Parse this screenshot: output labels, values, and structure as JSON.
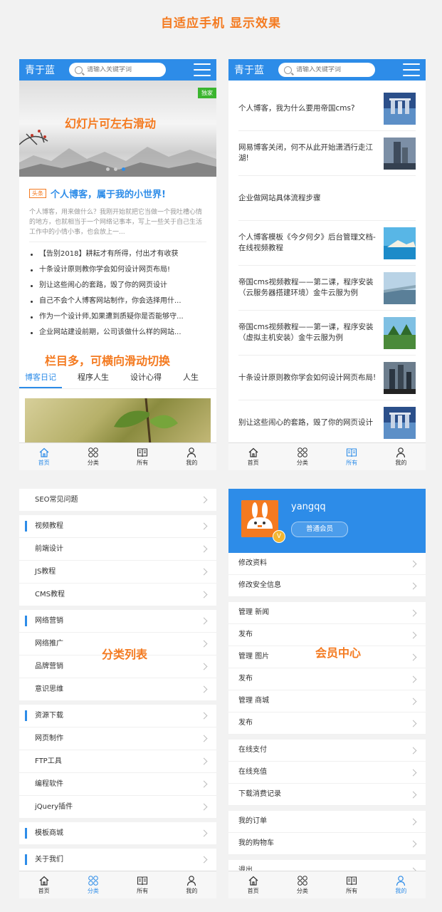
{
  "page_title": "自适应手机 显示效果",
  "header": {
    "logo": "青于蓝",
    "search_placeholder": "请输入关键字词"
  },
  "annotations": {
    "slider": "幻灯片可左右滑动",
    "tabs": "栏目多，可横向滑动切换",
    "category": "分类列表",
    "member": "会员中心"
  },
  "tabbar": [
    {
      "label": "首页",
      "icon": "home-icon"
    },
    {
      "label": "分类",
      "icon": "grid-icon"
    },
    {
      "label": "所有",
      "icon": "book-icon"
    },
    {
      "label": "我的",
      "icon": "user-icon"
    }
  ],
  "phone1": {
    "badge": "独家",
    "headline_tag": "头条",
    "headline_title": "个人博客，属于我的小世界!",
    "summary": "个人博客，用来做什么？我刚开始就把它当做一个我吐槽心情的地方，也就相当于一个网络记事本，写上一些关于自己生活工作中的小情小事，也会放上一...",
    "news": [
      "【告别2018】耕耘才有所得，付出才有收获",
      "十条设计原则教你学会如何设计网页布局!",
      "别让这些闹心的套路，毁了你的网页设计",
      "自己不会个人博客网站制作，你会选择用什...",
      "作为一个设计师,如果遭到质疑你是否能够守...",
      "企业网站建设前期，公司该做什么样的网站..."
    ],
    "tabs": [
      "博客日记",
      "程序人生",
      "设计心得",
      "人生"
    ]
  },
  "phone2": {
    "articles": [
      {
        "title": "个人博客，我为什么要用帝国cms?",
        "thumb": true
      },
      {
        "title": "网易博客关闭，何不从此开始潇洒行走江湖!",
        "thumb": true
      },
      {
        "title": "企业做网站具体流程步骤",
        "thumb": false
      },
      {
        "title": "个人博客模板《今夕何夕》后台管理文档-在线视频教程",
        "thumb": true
      },
      {
        "title": "帝国cms视频教程——第二课，程序安装（云服务器搭建环境）金牛云服为例",
        "thumb": true
      },
      {
        "title": "帝国cms视频教程——第一课，程序安装（虚拟主机安装）金牛云服为例",
        "thumb": true
      },
      {
        "title": "十条设计原则教你学会如何设计网页布局!",
        "thumb": true
      },
      {
        "title": "别让这些闹心的套路，毁了你的网页设计",
        "thumb": true
      }
    ]
  },
  "phone3": {
    "groups": [
      {
        "head": "SEO常见问题",
        "bar": false,
        "items": []
      },
      {
        "head": "视频教程",
        "bar": true,
        "items": [
          "前端设计",
          "JS教程",
          "CMS教程"
        ]
      },
      {
        "head": "网络营销",
        "bar": true,
        "items": [
          "网络推广",
          "品牌营销",
          "意识思维"
        ]
      },
      {
        "head": "资源下载",
        "bar": true,
        "items": [
          "网页制作",
          "FTP工具",
          "编程软件",
          "jQuery插件"
        ]
      },
      {
        "head": "模板商城",
        "bar": true,
        "items": []
      },
      {
        "head": "关于我们",
        "bar": true,
        "items": []
      }
    ]
  },
  "phone4": {
    "username": "yangqq",
    "level": "普通会员",
    "vbadge": "V",
    "groups": [
      [
        "修改资料",
        "修改安全信息"
      ],
      [
        "管理 新闻",
        "发布",
        "管理 图片",
        "发布",
        "管理 商城",
        "发布"
      ],
      [
        "在线支付",
        "在线充值",
        "下载消费记录"
      ],
      [
        "我的订单",
        "我的购物车"
      ],
      [
        "退出"
      ]
    ]
  },
  "colors": {
    "brand_blue": "#2d8ce8",
    "accent_orange": "#f47a20",
    "badge_green": "#3bb52f"
  }
}
